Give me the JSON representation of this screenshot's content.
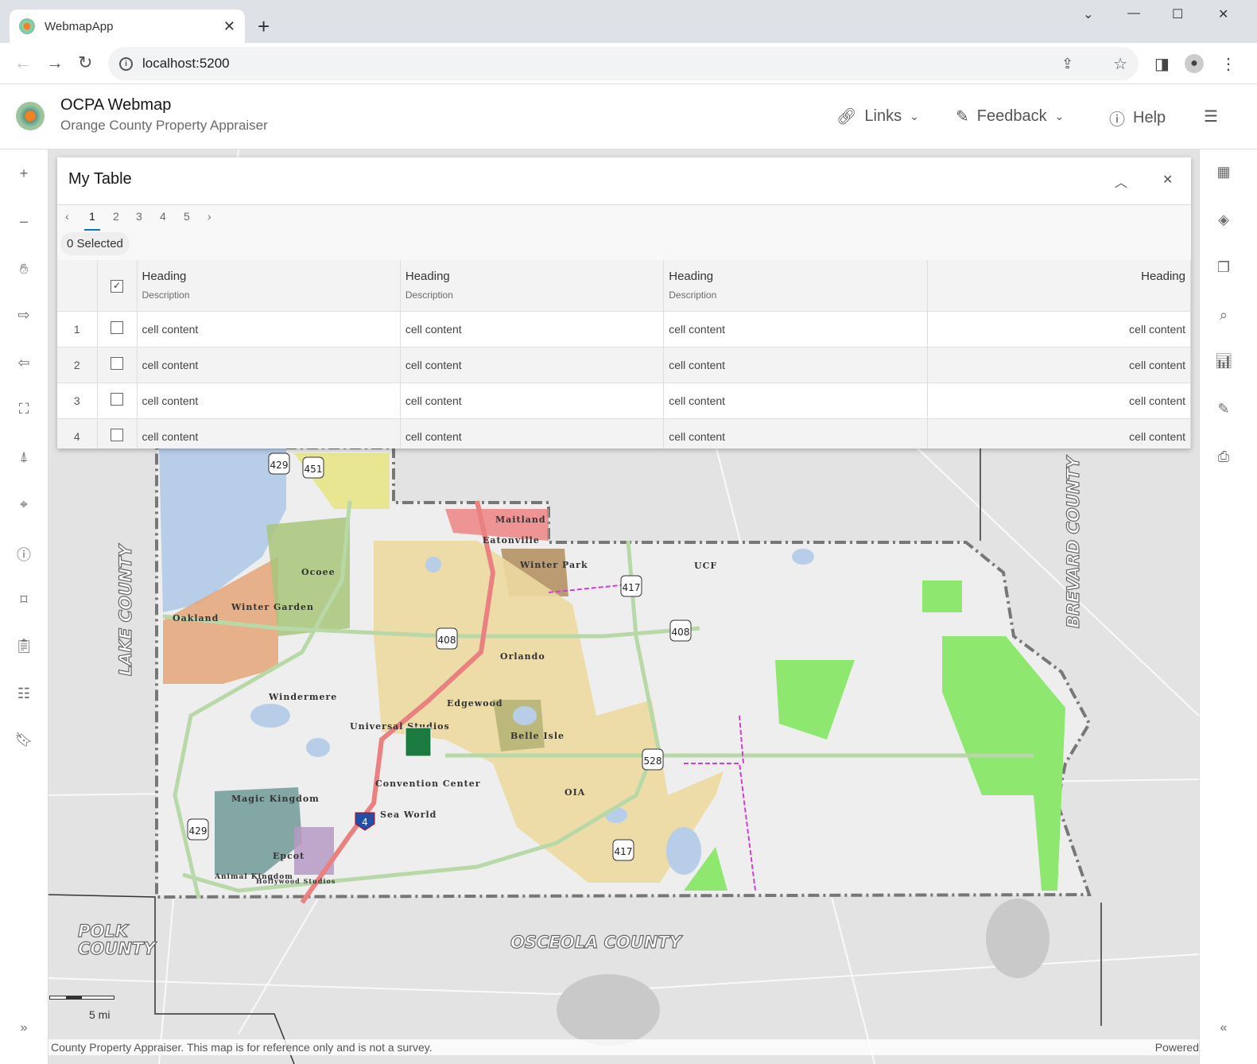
{
  "browser": {
    "tab_title": "WebmapApp",
    "url": "localhost:5200"
  },
  "app": {
    "title": "OCPA Webmap",
    "subtitle": "Orange County Property Appraiser",
    "nav": [
      {
        "label": "Links",
        "icon": "link-icon"
      },
      {
        "label": "Feedback",
        "icon": "feedback-icon"
      },
      {
        "label": "Help",
        "icon": "help-icon"
      }
    ]
  },
  "left_tools": [
    "zoom-in",
    "zoom-out",
    "pan",
    "forward",
    "back",
    "full-extent",
    "compass",
    "locate",
    "info",
    "measure",
    "clipboard",
    "legend",
    "bookmark"
  ],
  "right_tools": [
    "basemap-gallery",
    "layers",
    "layer-list",
    "search",
    "chart",
    "edit",
    "print"
  ],
  "table": {
    "title": "My Table",
    "pages": [
      "1",
      "2",
      "3",
      "4",
      "5"
    ],
    "active_page": "1",
    "selected": "0 Selected",
    "columns": [
      {
        "heading": "Heading",
        "description": "Description"
      },
      {
        "heading": "Heading",
        "description": "Description"
      },
      {
        "heading": "Heading",
        "description": "Description"
      },
      {
        "heading": "Heading",
        "description": ""
      }
    ],
    "rows": [
      {
        "n": "1",
        "cells": [
          "cell content",
          "cell content",
          "cell content",
          "cell content"
        ]
      },
      {
        "n": "2",
        "cells": [
          "cell content",
          "cell content",
          "cell content",
          "cell content"
        ]
      },
      {
        "n": "3",
        "cells": [
          "cell content",
          "cell content",
          "cell content",
          "cell content"
        ]
      },
      {
        "n": "4",
        "cells": [
          "cell content",
          "cell content",
          "cell content",
          "cell content"
        ]
      }
    ]
  },
  "map": {
    "counties": [
      "LAKE COUNTY",
      "BREVARD COUNTY",
      "POLK COUNTY",
      "OSCEOLA COUNTY"
    ],
    "places": [
      "Maitland",
      "Eatonville",
      "Winter Park",
      "UCF",
      "Ocoee",
      "Oakland",
      "Winter Garden",
      "Orlando",
      "Windermere",
      "Edgewood",
      "Universal Studios",
      "Belle Isle",
      "Convention Center",
      "Sea World",
      "OIA",
      "Magic Kingdom",
      "Epcot",
      "Animal Kingdom",
      "Hollywood Studios"
    ],
    "shields": [
      "429",
      "451",
      "417",
      "408",
      "408",
      "528",
      "417",
      "429",
      "4"
    ],
    "scale": "5 mi",
    "attribution": "County Property Appraiser. This map is for reference only and is not a survey.",
    "powered": "Powered"
  }
}
